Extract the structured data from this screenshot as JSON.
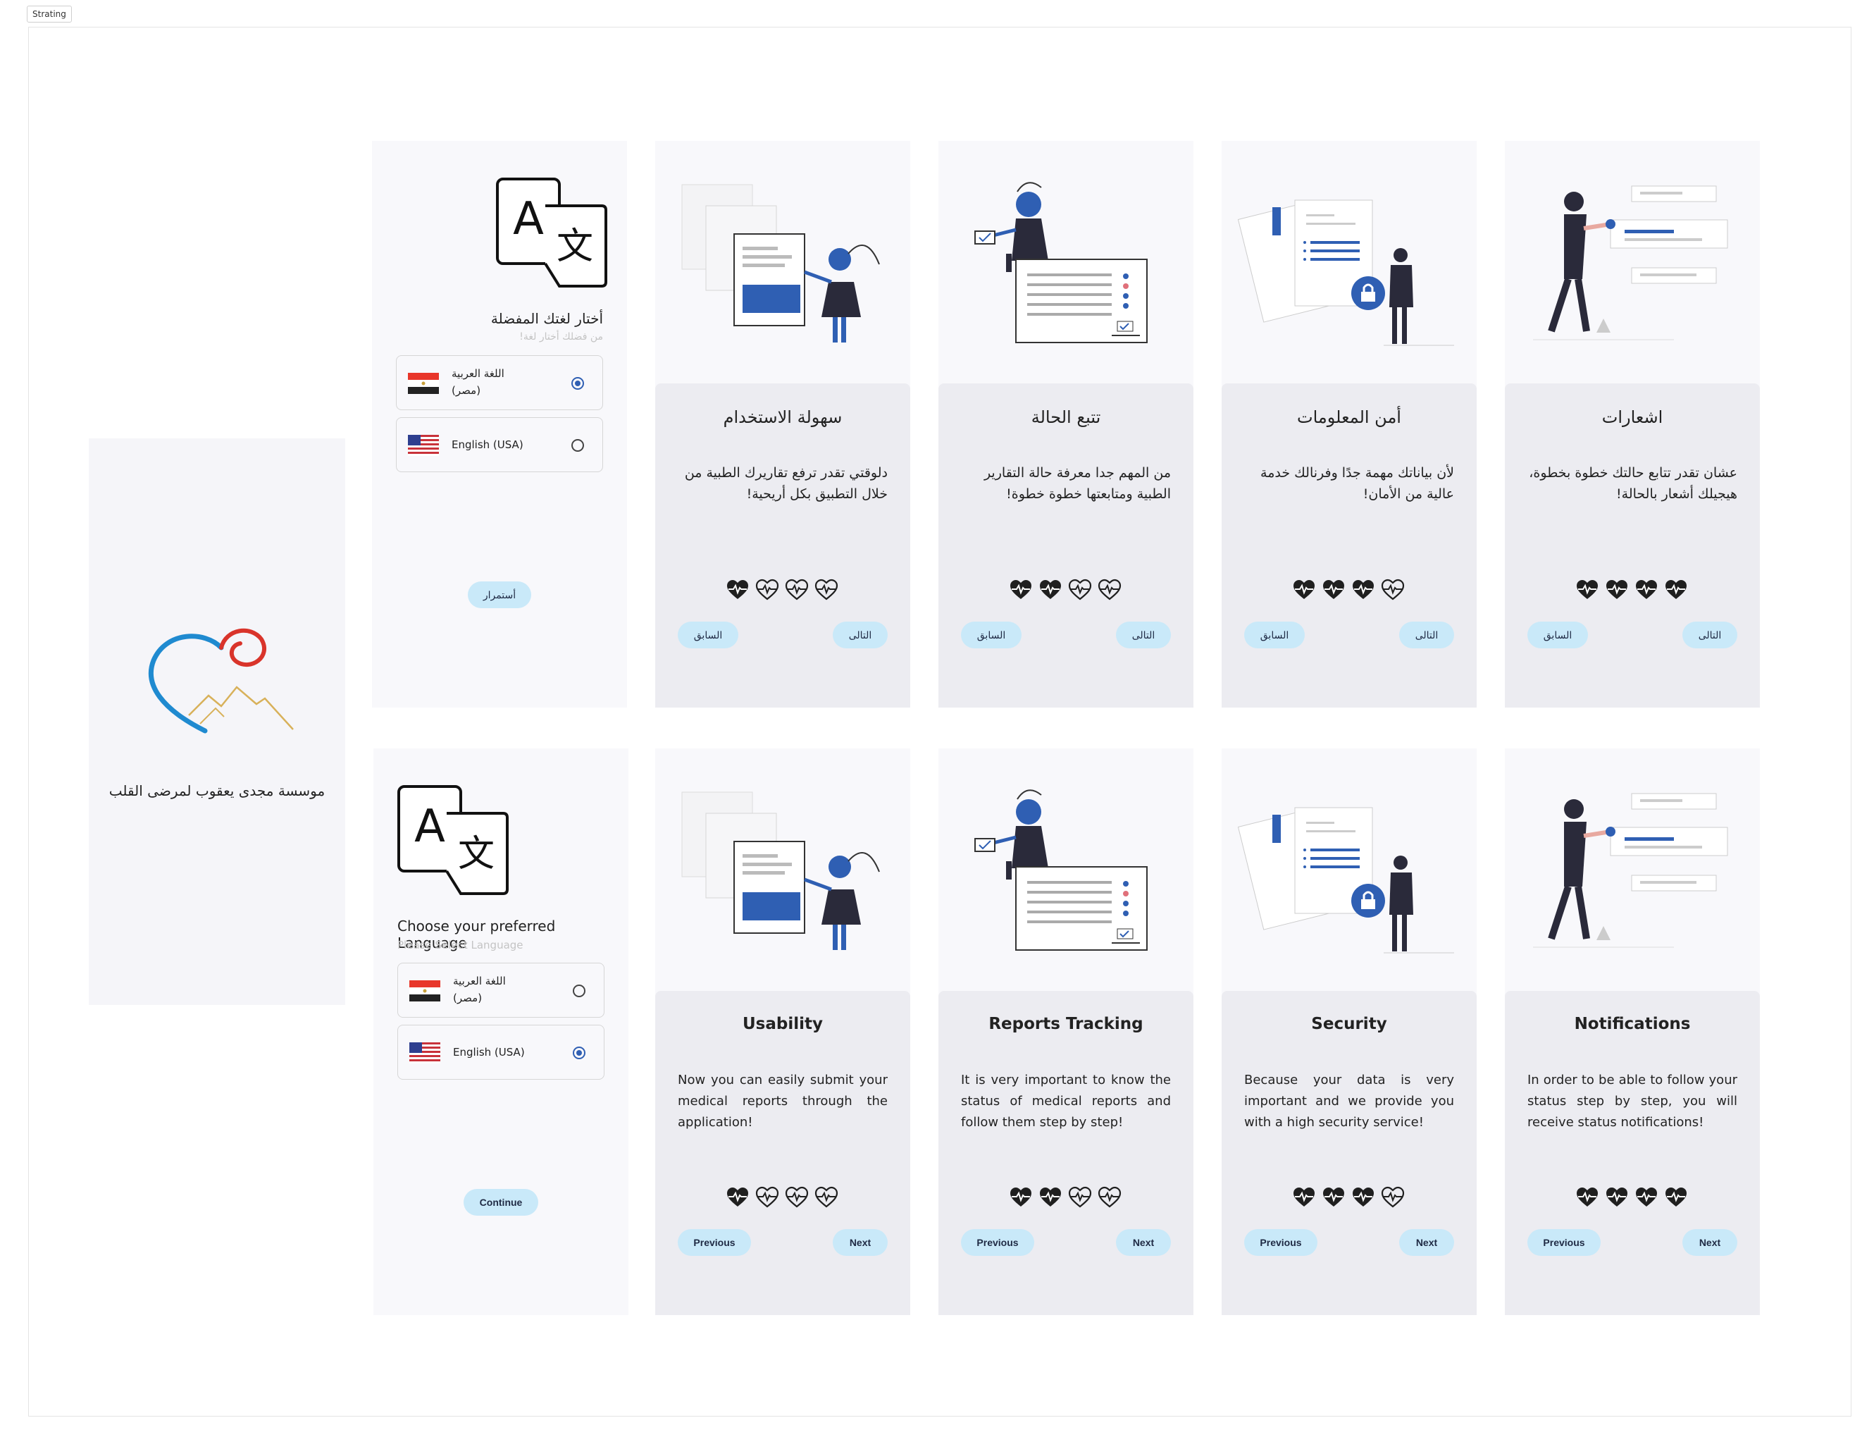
{
  "frame_label": "Strating",
  "splash": {
    "title": "موسسة مجدى يعقوب لمرضى القلب",
    "logo_icon": "heart-mountain-logo-icon"
  },
  "lang_ar": {
    "title": "أختار لغتك المفضلة",
    "subtitle": "من فضلك أختار لغة!",
    "options": [
      {
        "label_line1": "اللغة العربية",
        "label_line2": "(مصر)",
        "flag": "egypt-flag-icon",
        "selected": true
      },
      {
        "label": "English (USA)",
        "flag": "usa-flag-icon",
        "selected": false
      }
    ],
    "button": "أستمرار"
  },
  "lang_en": {
    "title": "Choose your preferred Language",
    "subtitle": "Please Select Language",
    "options": [
      {
        "label_line1": "اللغة العربية",
        "label_line2": "(مصر)",
        "flag": "egypt-flag-icon",
        "selected": false
      },
      {
        "label": "English (USA)",
        "flag": "usa-flag-icon",
        "selected": true
      }
    ],
    "button": "Continue"
  },
  "cards_ar": [
    {
      "title": "سهولة الاستخدام",
      "body": "دلوقتي تقدر ترفع تقاريرك الطبية من خلال التطبيق بكل أريحية!",
      "prev": "السابق",
      "next": "التالى",
      "filled_hearts": 1,
      "illustration": "documents-person-illustration"
    },
    {
      "title": "تتبع الحالة",
      "body": "من المهم جدا معرفة حالة التقارير الطبية ومتابعتها خطوة خطوة!",
      "prev": "السابق",
      "next": "التالى",
      "filled_hearts": 2,
      "illustration": "report-tracking-illustration"
    },
    {
      "title": "أمن المعلومات",
      "body": "لأن بياناتك مهمة جدًا وفرنالك خدمة عالية من الأمان!",
      "prev": "السابق",
      "next": "التالى",
      "filled_hearts": 3,
      "illustration": "security-lock-illustration"
    },
    {
      "title": "اشعارات",
      "body": "عشان تقدر تتابع حالتك خطوة بخطوة، هيجيلك أشعار  بالحالة!",
      "prev": "السابق",
      "next": "التالى",
      "filled_hearts": 4,
      "illustration": "notifications-walking-illustration"
    }
  ],
  "cards_en": [
    {
      "title": "Usability",
      "body": "Now you can easily submit your medical reports through the application!",
      "prev": "Previous",
      "next": "Next",
      "filled_hearts": 1,
      "illustration": "documents-person-illustration"
    },
    {
      "title": "Reports Tracking",
      "body": "It is very important to know the status of medical reports and follow them step by step!",
      "prev": "Previous",
      "next": "Next",
      "filled_hearts": 2,
      "illustration": "report-tracking-illustration"
    },
    {
      "title": "Security",
      "body": "Because your data is very important and we provide you with a high security service!",
      "prev": "Previous",
      "next": "Next",
      "filled_hearts": 3,
      "illustration": "security-lock-illustration"
    },
    {
      "title": "Notifications",
      "body": "In order to be able to follow your status step by step, you will receive status notifications!",
      "prev": "Previous",
      "next": "Next",
      "filled_hearts": 4,
      "illustration": "notifications-walking-illustration"
    }
  ],
  "colors": {
    "accent_blue": "#2f5fb3",
    "pill_bg": "#c9e9f9",
    "screen_bg": "#f8f8fb",
    "panel_bg": "#ececf1",
    "logo_blue": "#1f8ad0",
    "logo_red": "#d9342b",
    "logo_gold": "#d8b15a"
  }
}
